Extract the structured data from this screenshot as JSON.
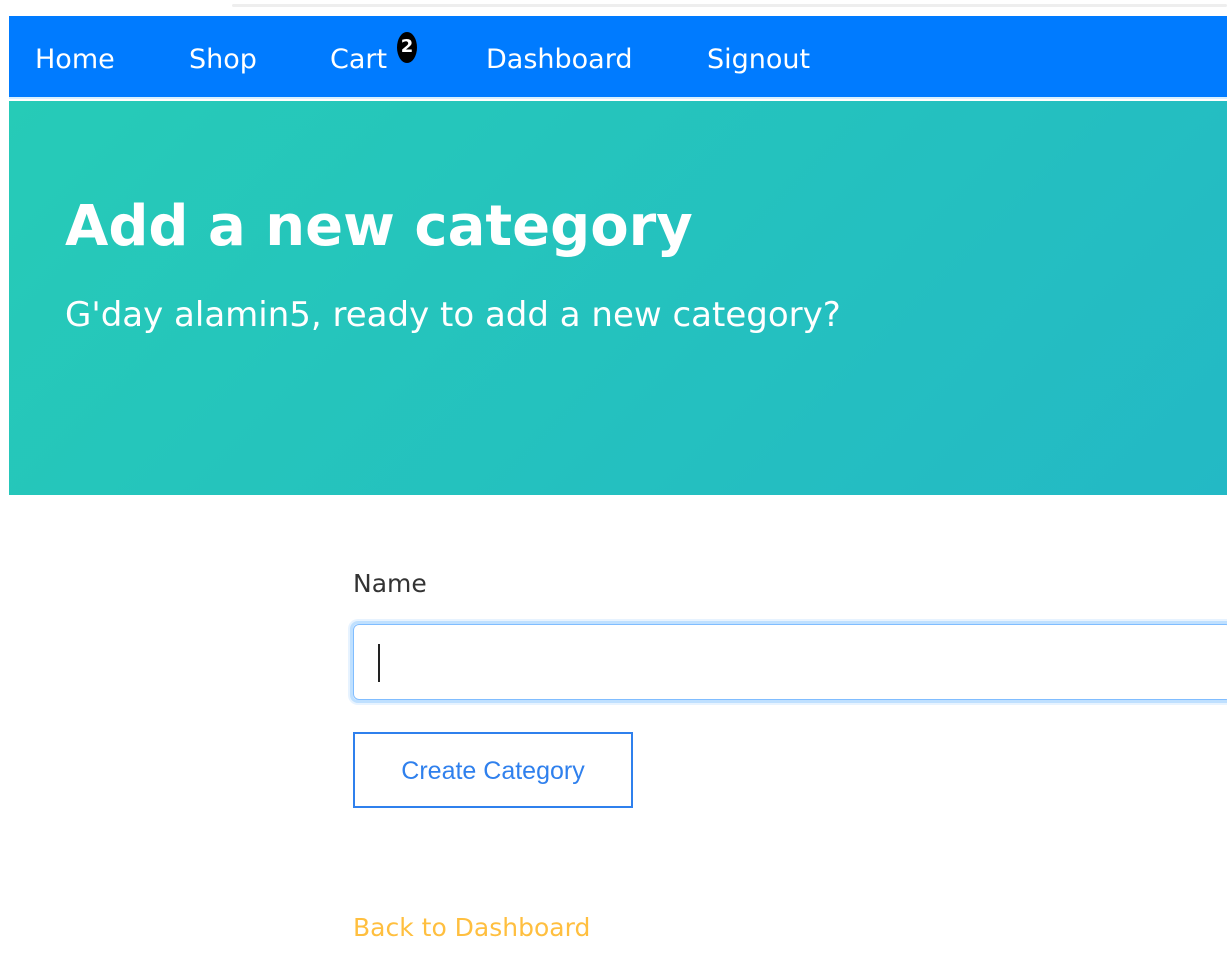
{
  "nav": {
    "home": "Home",
    "shop": "Shop",
    "cart": "Cart",
    "cart_count": "2",
    "dashboard": "Dashboard",
    "signout": "Signout"
  },
  "hero": {
    "title": "Add a new category",
    "subtitle": "G'day alamin5, ready to add a new category?"
  },
  "form": {
    "name_label": "Name",
    "name_value": "",
    "submit_label": "Create Category"
  },
  "links": {
    "back_to_dashboard": "Back to Dashboard"
  },
  "colors": {
    "navbar": "#007bff",
    "hero_start": "#26cbb7",
    "hero_end": "#23b9c5",
    "button_accent": "#2f80ed",
    "link_accent": "#ffbf3f"
  }
}
